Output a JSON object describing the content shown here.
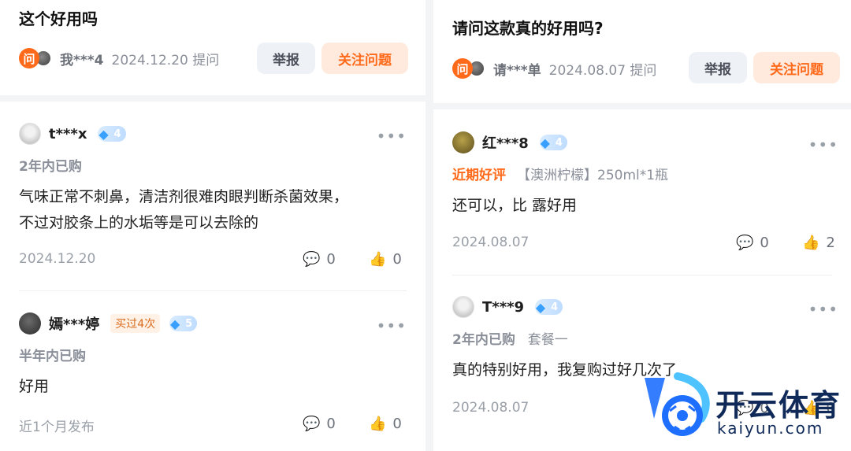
{
  "left": {
    "question": {
      "title": "这个好用吗",
      "ask_badge": "问",
      "user": "我***4",
      "date_text": "2024.12.20 提问",
      "report_label": "举报",
      "follow_label": "关注问题"
    },
    "reviews": [
      {
        "user": "t***x",
        "vip_level": "4",
        "purchase": "2年内已购",
        "body_lines": [
          "气味正常不刺鼻，清洁剂很难肉眼判断杀菌效果，",
          "不过对胶条上的水垢等是可以去除的"
        ],
        "date": "2024.12.20",
        "comments": "0",
        "likes": "0"
      },
      {
        "user": "嫣***婷",
        "bought_tag": "买过4次",
        "vip_level": "5",
        "purchase": "半年内已购",
        "body_lines": [
          "好用"
        ],
        "date": "近1个月发布",
        "comments": "0",
        "likes": "0"
      }
    ]
  },
  "right": {
    "question": {
      "title": "请问这款真的好用吗?",
      "ask_badge": "问",
      "user": "请***单",
      "date_text": "2024.08.07 提问",
      "report_label": "举报",
      "follow_label": "关注问题"
    },
    "reviews": [
      {
        "user": "红***8",
        "vip_level": "4",
        "hot_label": "近期好评",
        "spec": "【澳洲柠檬】250ml*1瓶",
        "body_lines": [
          "还可以，比  露好用"
        ],
        "date": "2024.08.07",
        "comments": "0",
        "likes": "2"
      },
      {
        "user": "T***9",
        "vip_level": "4",
        "purchase": "2年内已购",
        "spec": "套餐一",
        "body_lines": [
          "真的特别好用，我复购过好几次了"
        ],
        "date": "2024.08.07",
        "comments": "0",
        "likes": "0"
      }
    ]
  },
  "watermark": {
    "title": "开云体育",
    "sub": "kaiyun.com"
  },
  "icons": {
    "more": "more-dots-icon",
    "comment": "comment-bubble-icon",
    "like": "thumbs-up-icon",
    "vip": "diamond-icon"
  },
  "colors": {
    "accent": "#ff6a1a",
    "follow_bg": "#ffeadd",
    "report_bg": "#eef2f7",
    "vip": "#3aa0ff"
  }
}
